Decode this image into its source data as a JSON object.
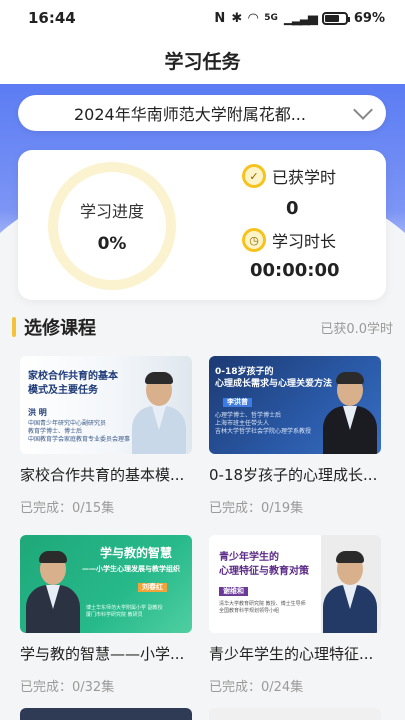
{
  "status_bar": {
    "time": "16:44",
    "network": "5G",
    "battery": "69%"
  },
  "header": {
    "title": "学习任务"
  },
  "course_select": {
    "selected": "2024年华南师范大学附属花都..."
  },
  "stats": {
    "progress_label": "学习进度",
    "progress_value": "0%",
    "earned_hours_label": "已获学时",
    "earned_hours_value": "0",
    "study_time_label": "学习时长",
    "study_time_value": "00:00:00"
  },
  "section": {
    "title": "选修课程",
    "earned": "已获0.0学时"
  },
  "courses": [
    {
      "title": "家校合作共育的基本模...",
      "progress": "已完成：0/15集",
      "thumb_heading": "家校合作共育的基本\n模式及主要任务",
      "thumb_name": "洪 明",
      "thumb_desc": "中国青少年研究中心副研究员\n教育学博士、博士后\n中国教育学会家庭教育专业委员会理事"
    },
    {
      "title": "0-18岁孩子的心理成长...",
      "progress": "已完成：0/19集",
      "thumb_heading": "0-18岁孩子的\n心理成长需求与心理关爱方法",
      "thumb_name": "李洪曾",
      "thumb_desc": "心理学博士、哲学博士后\n上海市班主任带头人\n吉林大学哲学社会学院心理学系教授"
    },
    {
      "title": "学与教的智慧——小学...",
      "progress": "已完成：0/32集",
      "thumb_heading": "学与教的智慧",
      "thumb_sub": "——小学生心理发展与教学组织",
      "thumb_name": "刘春红",
      "thumb_desc": "博士华东师范大学附属小学 副教授\n厦门市科学研究院 教研员"
    },
    {
      "title": "青少年学生的心理特征...",
      "progress": "已完成：0/24集",
      "thumb_heading": "青少年学生的\n心理特征与教育对策",
      "thumb_name": "谢维和",
      "thumb_desc": "清华大学教育研究院 教授、博士生导师\n全国教育科学规划领导小组"
    }
  ],
  "colors": {
    "accent": "#f2c33a",
    "hero": "#5b7cf3"
  },
  "icons": {
    "dropdown": "chevron-down-icon",
    "earned": "check-badge-icon",
    "time": "clock-icon"
  }
}
